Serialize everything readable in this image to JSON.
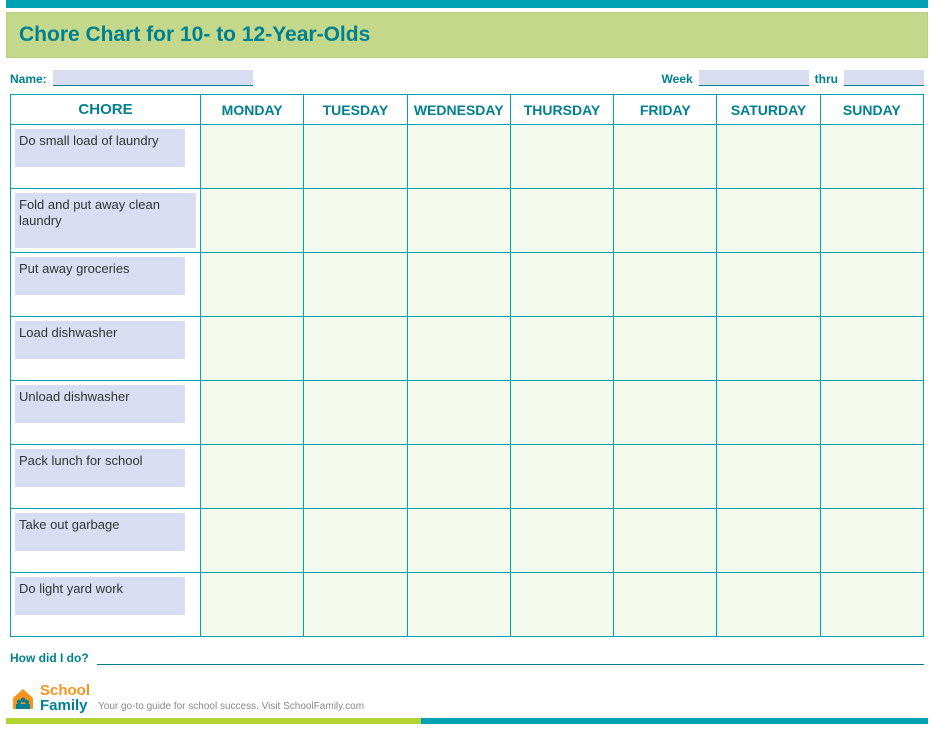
{
  "title": "Chore Chart for 10- to 12-Year-Olds",
  "labels": {
    "name": "Name:",
    "week": "Week",
    "thru": "thru",
    "how": "How did I do?"
  },
  "columns": {
    "chore": "CHORE",
    "days": [
      "MONDAY",
      "TUESDAY",
      "WEDNESDAY",
      "THURSDAY",
      "FRIDAY",
      "SATURDAY",
      "SUNDAY"
    ]
  },
  "chores": [
    "Do small load of laundry",
    "Fold and put away clean laundry",
    "Put away groceries",
    "Load dishwasher",
    "Unload dishwasher",
    "Pack lunch for school",
    "Take out garbage",
    "Do light yard work"
  ],
  "logo": {
    "line1": "School",
    "line2": "Family"
  },
  "tagline": "Your go-to guide for school success. Visit SchoolFamily.com"
}
